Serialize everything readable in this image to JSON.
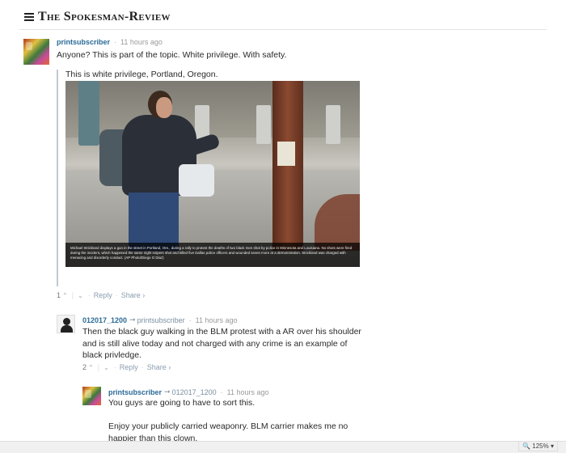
{
  "site": {
    "title": "The Spokesman-Review"
  },
  "comments": [
    {
      "user": "printsubscriber",
      "time": "11 hours ago",
      "text": "Anyone? This is part of the topic. White privilege. With safety.",
      "quote": {
        "text": "This is white privilege, Portland, Oregon.",
        "image_caption": "Michael Strickland displays a gun in the street in Portland, Ore., during a rally to protest the deaths of two black men shot by police in Minnesota and Louisiana. No shots were fired during the incident, which happened the same night snipers shot and killed five Dallas police officers and wounded seven more at a demonstration. Strickland was charged with menacing and disorderly conduct. (AP Photo/Diego G Diaz)"
      },
      "votes": "1",
      "reply_label": "Reply",
      "share_label": "Share ›"
    },
    {
      "user": "012017_1200",
      "reply_to": "printsubscriber",
      "time": "11 hours ago",
      "text_lines": [
        "Then the black guy walking in the BLM protest with a AR over his shoulder",
        "and is still alive today and not charged with any crime is an example of",
        "black privledge."
      ],
      "votes": "2",
      "reply_label": "Reply",
      "share_label": "Share ›"
    },
    {
      "user": "printsubscriber",
      "reply_to": "012017_1200",
      "time": "11 hours ago",
      "text_lines": [
        "You guys are going to have to sort this.",
        "",
        "Enjoy your publicly carried weaponry. BLM carrier makes me no",
        "happier than this clown."
      ]
    }
  ],
  "status": {
    "zoom": "125%"
  }
}
